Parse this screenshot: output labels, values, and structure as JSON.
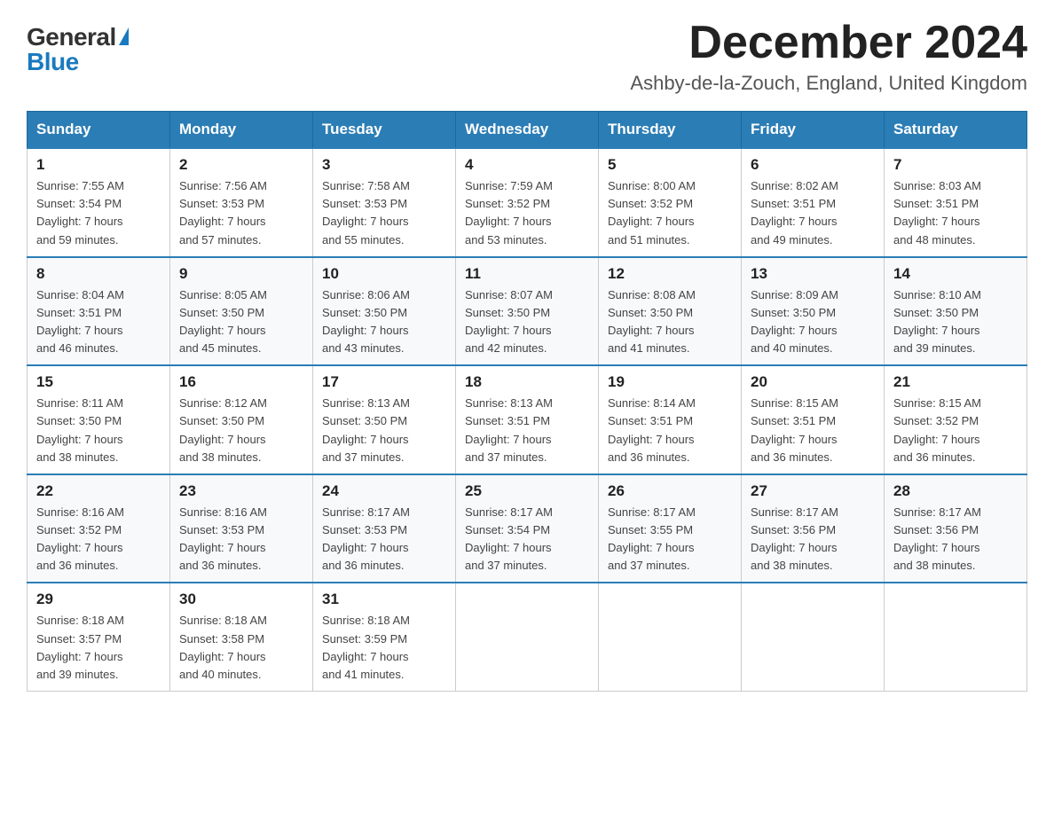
{
  "header": {
    "logo_general": "General",
    "logo_blue": "Blue",
    "month_title": "December 2024",
    "subtitle": "Ashby-de-la-Zouch, England, United Kingdom"
  },
  "days_of_week": [
    "Sunday",
    "Monday",
    "Tuesday",
    "Wednesday",
    "Thursday",
    "Friday",
    "Saturday"
  ],
  "weeks": [
    [
      {
        "day": "1",
        "sunrise": "7:55 AM",
        "sunset": "3:54 PM",
        "daylight": "7 hours and 59 minutes."
      },
      {
        "day": "2",
        "sunrise": "7:56 AM",
        "sunset": "3:53 PM",
        "daylight": "7 hours and 57 minutes."
      },
      {
        "day": "3",
        "sunrise": "7:58 AM",
        "sunset": "3:53 PM",
        "daylight": "7 hours and 55 minutes."
      },
      {
        "day": "4",
        "sunrise": "7:59 AM",
        "sunset": "3:52 PM",
        "daylight": "7 hours and 53 minutes."
      },
      {
        "day": "5",
        "sunrise": "8:00 AM",
        "sunset": "3:52 PM",
        "daylight": "7 hours and 51 minutes."
      },
      {
        "day": "6",
        "sunrise": "8:02 AM",
        "sunset": "3:51 PM",
        "daylight": "7 hours and 49 minutes."
      },
      {
        "day": "7",
        "sunrise": "8:03 AM",
        "sunset": "3:51 PM",
        "daylight": "7 hours and 48 minutes."
      }
    ],
    [
      {
        "day": "8",
        "sunrise": "8:04 AM",
        "sunset": "3:51 PM",
        "daylight": "7 hours and 46 minutes."
      },
      {
        "day": "9",
        "sunrise": "8:05 AM",
        "sunset": "3:50 PM",
        "daylight": "7 hours and 45 minutes."
      },
      {
        "day": "10",
        "sunrise": "8:06 AM",
        "sunset": "3:50 PM",
        "daylight": "7 hours and 43 minutes."
      },
      {
        "day": "11",
        "sunrise": "8:07 AM",
        "sunset": "3:50 PM",
        "daylight": "7 hours and 42 minutes."
      },
      {
        "day": "12",
        "sunrise": "8:08 AM",
        "sunset": "3:50 PM",
        "daylight": "7 hours and 41 minutes."
      },
      {
        "day": "13",
        "sunrise": "8:09 AM",
        "sunset": "3:50 PM",
        "daylight": "7 hours and 40 minutes."
      },
      {
        "day": "14",
        "sunrise": "8:10 AM",
        "sunset": "3:50 PM",
        "daylight": "7 hours and 39 minutes."
      }
    ],
    [
      {
        "day": "15",
        "sunrise": "8:11 AM",
        "sunset": "3:50 PM",
        "daylight": "7 hours and 38 minutes."
      },
      {
        "day": "16",
        "sunrise": "8:12 AM",
        "sunset": "3:50 PM",
        "daylight": "7 hours and 38 minutes."
      },
      {
        "day": "17",
        "sunrise": "8:13 AM",
        "sunset": "3:50 PM",
        "daylight": "7 hours and 37 minutes."
      },
      {
        "day": "18",
        "sunrise": "8:13 AM",
        "sunset": "3:51 PM",
        "daylight": "7 hours and 37 minutes."
      },
      {
        "day": "19",
        "sunrise": "8:14 AM",
        "sunset": "3:51 PM",
        "daylight": "7 hours and 36 minutes."
      },
      {
        "day": "20",
        "sunrise": "8:15 AM",
        "sunset": "3:51 PM",
        "daylight": "7 hours and 36 minutes."
      },
      {
        "day": "21",
        "sunrise": "8:15 AM",
        "sunset": "3:52 PM",
        "daylight": "7 hours and 36 minutes."
      }
    ],
    [
      {
        "day": "22",
        "sunrise": "8:16 AM",
        "sunset": "3:52 PM",
        "daylight": "7 hours and 36 minutes."
      },
      {
        "day": "23",
        "sunrise": "8:16 AM",
        "sunset": "3:53 PM",
        "daylight": "7 hours and 36 minutes."
      },
      {
        "day": "24",
        "sunrise": "8:17 AM",
        "sunset": "3:53 PM",
        "daylight": "7 hours and 36 minutes."
      },
      {
        "day": "25",
        "sunrise": "8:17 AM",
        "sunset": "3:54 PM",
        "daylight": "7 hours and 37 minutes."
      },
      {
        "day": "26",
        "sunrise": "8:17 AM",
        "sunset": "3:55 PM",
        "daylight": "7 hours and 37 minutes."
      },
      {
        "day": "27",
        "sunrise": "8:17 AM",
        "sunset": "3:56 PM",
        "daylight": "7 hours and 38 minutes."
      },
      {
        "day": "28",
        "sunrise": "8:17 AM",
        "sunset": "3:56 PM",
        "daylight": "7 hours and 38 minutes."
      }
    ],
    [
      {
        "day": "29",
        "sunrise": "8:18 AM",
        "sunset": "3:57 PM",
        "daylight": "7 hours and 39 minutes."
      },
      {
        "day": "30",
        "sunrise": "8:18 AM",
        "sunset": "3:58 PM",
        "daylight": "7 hours and 40 minutes."
      },
      {
        "day": "31",
        "sunrise": "8:18 AM",
        "sunset": "3:59 PM",
        "daylight": "7 hours and 41 minutes."
      },
      null,
      null,
      null,
      null
    ]
  ],
  "labels": {
    "sunrise": "Sunrise:",
    "sunset": "Sunset:",
    "daylight": "Daylight:"
  }
}
